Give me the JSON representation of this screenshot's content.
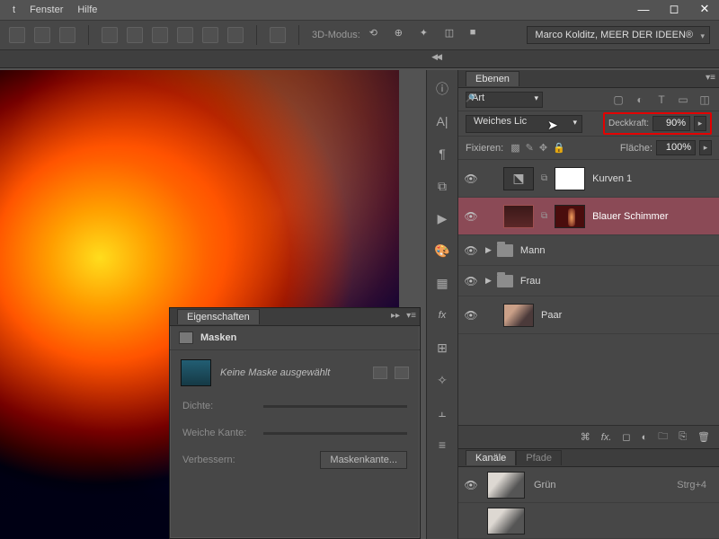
{
  "menu": {
    "items": [
      "t",
      "Fenster",
      "Hilfe"
    ]
  },
  "optbar": {
    "mode_label": "3D-Modus:",
    "profile": "Marco Kolditz, MEER DER IDEEN®"
  },
  "layers_panel": {
    "title": "Ebenen",
    "filter_mode": "Art",
    "blend_mode": "Weiches Lic",
    "opacity_label": "Deckkraft:",
    "opacity_value": "90%",
    "lock_label": "Fixieren:",
    "fill_label": "Fläche:",
    "fill_value": "100%",
    "layers": [
      {
        "name": "Kurven 1"
      },
      {
        "name": "Blauer Schimmer"
      },
      {
        "name": "Mann"
      },
      {
        "name": "Frau"
      },
      {
        "name": "Paar"
      }
    ]
  },
  "channels_panel": {
    "tabs": [
      "Kanäle",
      "Pfade"
    ],
    "rows": [
      {
        "name": "Grün",
        "shortcut": "Strg+4"
      }
    ]
  },
  "props_panel": {
    "title": "Eigenschaften",
    "section": "Masken",
    "empty_text": "Keine Maske ausgewählt",
    "density_label": "Dichte:",
    "feather_label": "Weiche Kante:",
    "refine_label": "Verbessern:",
    "refine_button": "Maskenkante..."
  }
}
